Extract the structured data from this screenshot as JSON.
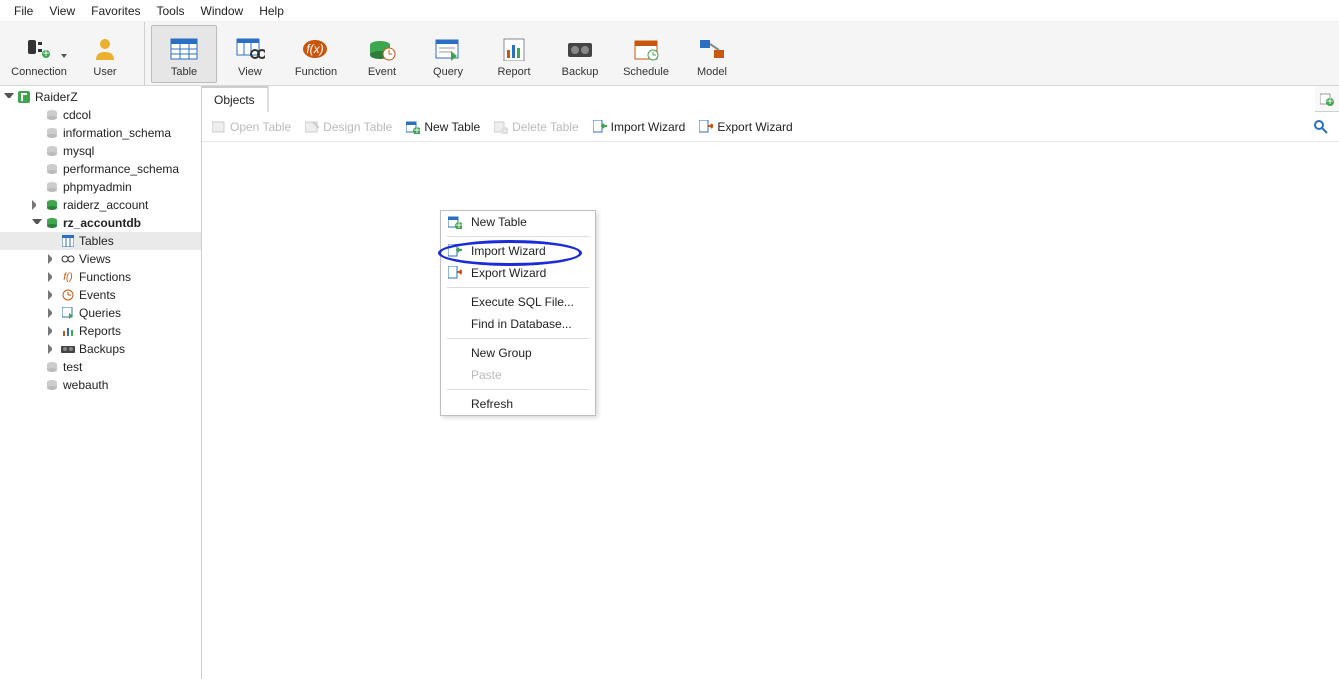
{
  "menu": {
    "items": [
      "File",
      "View",
      "Favorites",
      "Tools",
      "Window",
      "Help"
    ]
  },
  "toolbar": {
    "connection": "Connection",
    "user": "User",
    "table": "Table",
    "view": "View",
    "function": "Function",
    "event": "Event",
    "query": "Query",
    "report": "Report",
    "backup": "Backup",
    "schedule": "Schedule",
    "model": "Model"
  },
  "tree": {
    "connection": "RaiderZ",
    "databases": [
      {
        "name": "cdcol",
        "active": false
      },
      {
        "name": "information_schema",
        "active": false
      },
      {
        "name": "mysql",
        "active": false
      },
      {
        "name": "performance_schema",
        "active": false
      },
      {
        "name": "phpmyadmin",
        "active": false
      },
      {
        "name": "raiderz_account",
        "active": true,
        "expand_hint": true
      },
      {
        "name": "rz_accountdb",
        "active": true,
        "expanded": true
      }
    ],
    "folders": {
      "tables": "Tables",
      "views": "Views",
      "functions": "Functions",
      "events": "Events",
      "queries": "Queries",
      "reports": "Reports",
      "backups": "Backups"
    },
    "trailing": [
      {
        "name": "test"
      },
      {
        "name": "webauth"
      }
    ]
  },
  "tabs": {
    "objects": "Objects"
  },
  "actions": {
    "open_table": "Open Table",
    "design_table": "Design Table",
    "new_table": "New Table",
    "delete_table": "Delete Table",
    "import_wizard": "Import Wizard",
    "export_wizard": "Export Wizard"
  },
  "context_menu": {
    "new_table": "New Table",
    "import_wizard": "Import Wizard",
    "export_wizard": "Export Wizard",
    "execute_sql": "Execute SQL File...",
    "find_db": "Find in Database...",
    "new_group": "New Group",
    "paste": "Paste",
    "refresh": "Refresh"
  }
}
